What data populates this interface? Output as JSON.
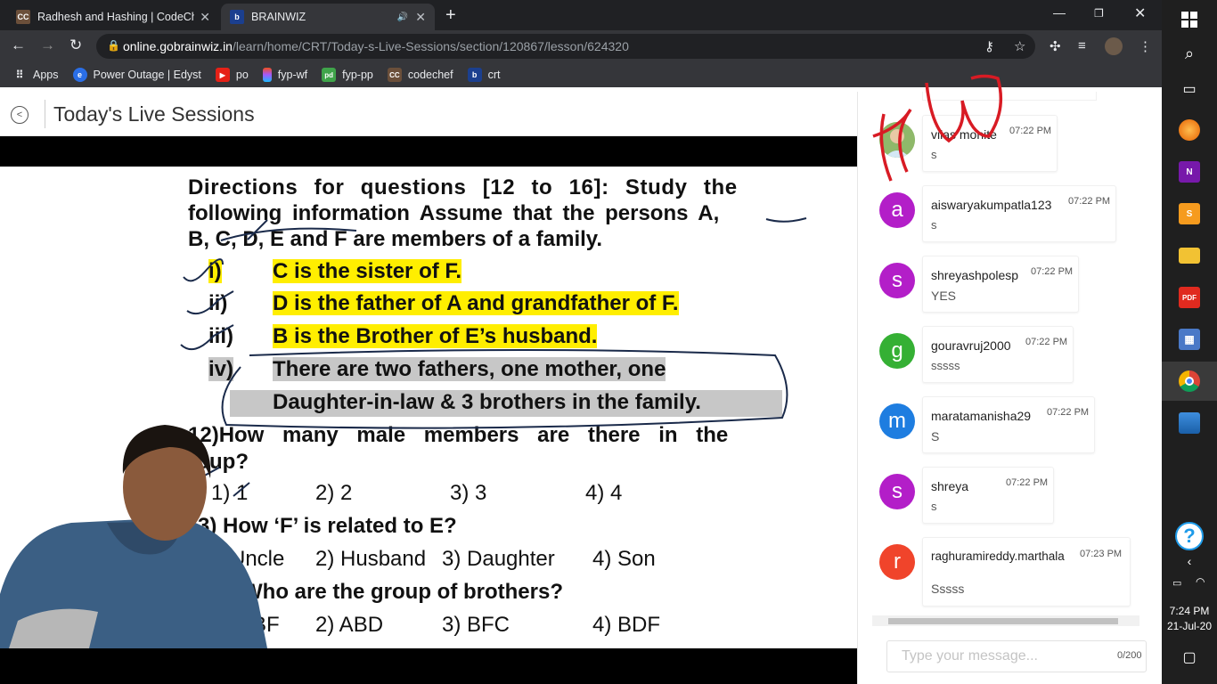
{
  "browser": {
    "tabs": [
      {
        "title": "Radhesh and Hashing | CodeChef",
        "favicon": "CC",
        "active": false
      },
      {
        "title": "BRAINWIZ",
        "favicon": "b",
        "active": true
      }
    ],
    "url_host": "online.gobrainwiz.in",
    "url_path": "/learn/home/CRT/Today-s-Live-Sessions/section/120867/lesson/624320",
    "bookmarks": [
      {
        "label": "Apps",
        "icon": "apps-grid-icon"
      },
      {
        "label": "Power Outage | Edyst",
        "icon": "edyst-icon"
      },
      {
        "label": "po",
        "icon": "youtube-icon"
      },
      {
        "label": "fyp-wf",
        "icon": "figma-icon"
      },
      {
        "label": "fyp-pp",
        "icon": "pd-icon"
      },
      {
        "label": "codechef",
        "icon": "codechef-icon"
      },
      {
        "label": "crt",
        "icon": "brainwiz-icon"
      }
    ]
  },
  "page": {
    "title": "Today's Live Sessions"
  },
  "slide": {
    "directions": [
      "Directions for questions [12 to 16]: Study the",
      "following information Assume that the persons A,",
      "B, C, D, E and F are members of a family."
    ],
    "facts": [
      {
        "num": "i)",
        "text": "C is the sister of F."
      },
      {
        "num": "ii)",
        "text": "D is the father of A and grandfather of F."
      },
      {
        "num": "iii)",
        "text": "B is the Brother of E’s husband."
      },
      {
        "num": "iv)",
        "text": "There are two fathers, one mother, one"
      },
      {
        "num": "",
        "text": "Daughter-in-law & 3 brothers in the family."
      }
    ],
    "q12": [
      "12)How many male members are there in the",
      "roup?"
    ],
    "q12_options": [
      "1) 1",
      "2) 2",
      "3) 3",
      "4) 4"
    ],
    "q13": "3) How ‘F’ is related to E?",
    "q13_options": [
      "Uncle",
      "2) Husband",
      "3) Daughter",
      "4) Son"
    ],
    "q14": "Who are the group of brothers?",
    "q14_options": [
      "BF",
      "2) ABD",
      "3) BFC",
      "4) BDF"
    ]
  },
  "chat": {
    "messages": [
      {
        "user": "vilas monite",
        "time": "07:22 PM",
        "text": "s",
        "initial": "",
        "color": "#7cae5a",
        "photo": true
      },
      {
        "user": "aiswaryakumpatla123",
        "time": "07:22 PM",
        "text": "s",
        "initial": "a",
        "color": "#b31ec8"
      },
      {
        "user": "shreyashpolesp",
        "time": "07:22 PM",
        "text": "YES",
        "initial": "s",
        "color": "#b31ec8"
      },
      {
        "user": "gouravruj2000",
        "time": "07:22 PM",
        "text": "sssss",
        "initial": "g",
        "color": "#35b034"
      },
      {
        "user": "maratamanisha29",
        "time": "07:22 PM",
        "text": "S",
        "initial": "m",
        "color": "#1e7de0"
      },
      {
        "user": "shreya",
        "time": "07:22 PM",
        "text": "s",
        "initial": "s",
        "color": "#b31ec8"
      },
      {
        "user": "raghuramireddy.marthala",
        "time": "07:23 PM",
        "text": "Sssss",
        "initial": "r",
        "color": "#f0442b"
      }
    ],
    "input_placeholder": "Type your message...",
    "char_count": "0/200"
  },
  "taskbar": {
    "time": "7:24 PM",
    "date": "21-Jul-20",
    "apps": [
      "windows-start-icon",
      "search-icon",
      "task-view-icon",
      "firefox-icon",
      "onenote-icon",
      "sublime-text-icon",
      "file-explorer-icon",
      "pdf-reader-icon",
      "calculator-icon",
      "chrome-icon",
      "photos-icon"
    ]
  }
}
